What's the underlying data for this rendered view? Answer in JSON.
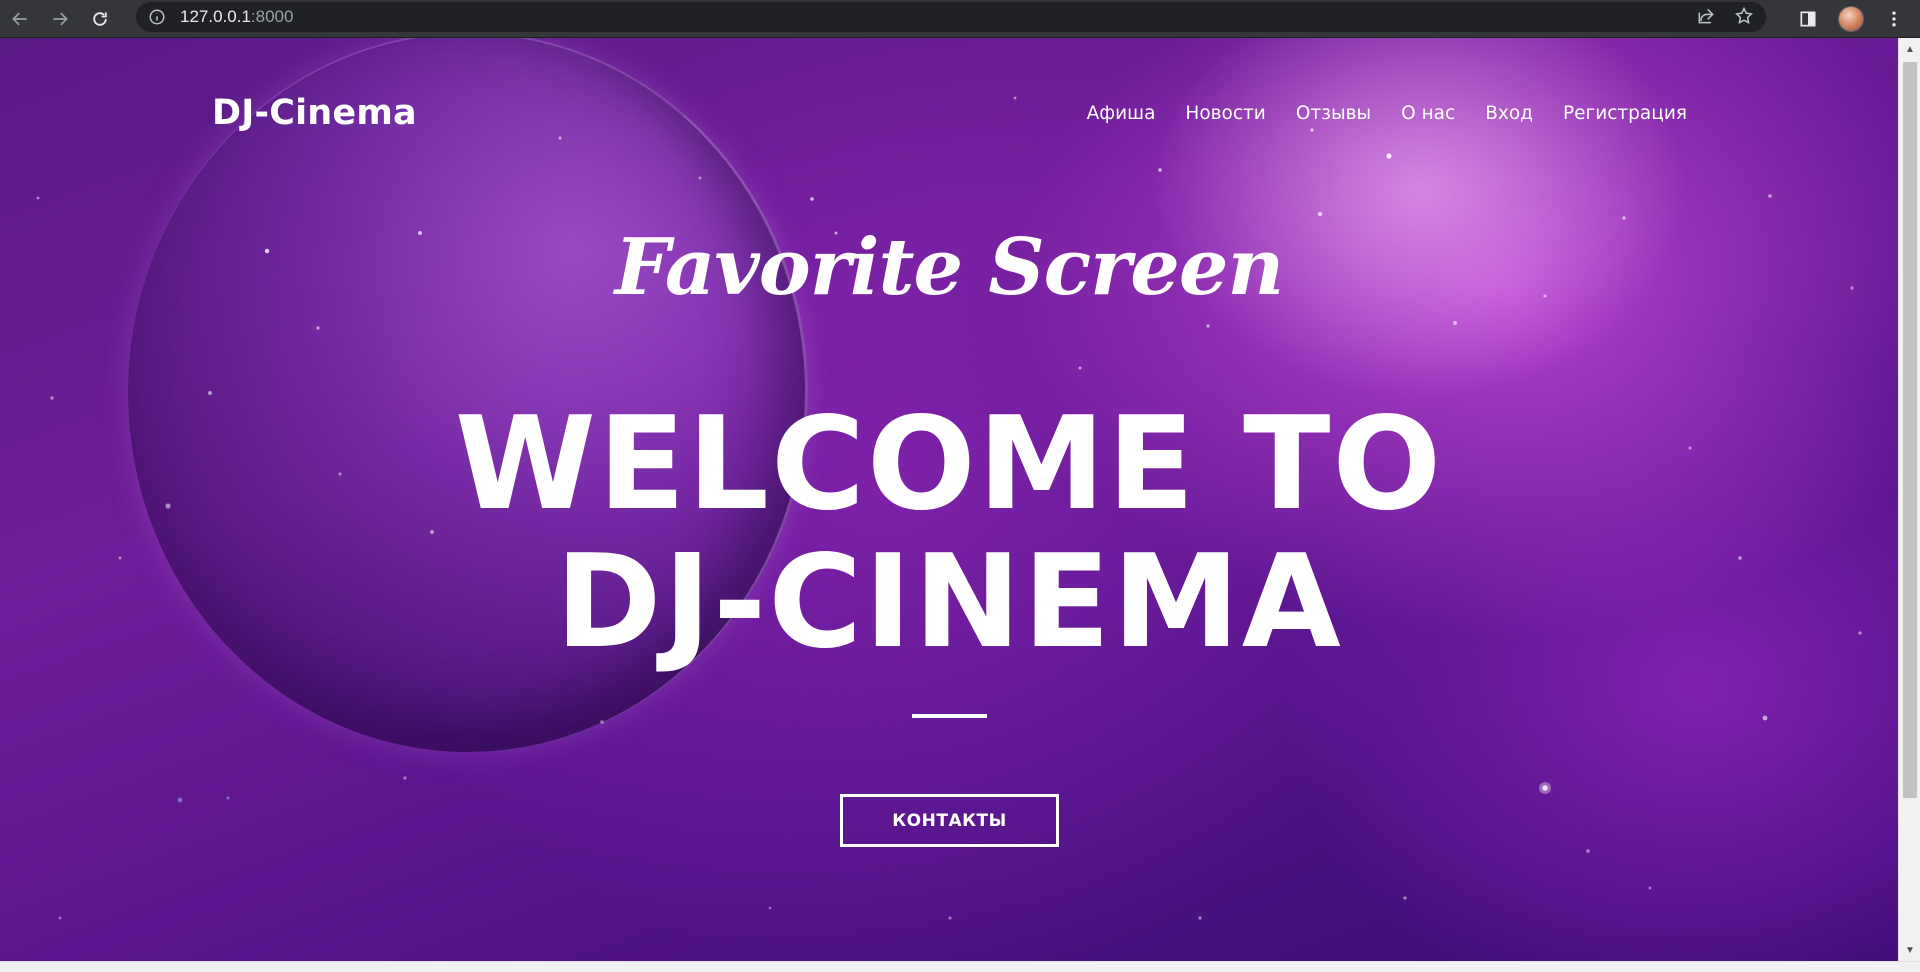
{
  "browser": {
    "url_host": "127.0.0.1",
    "url_port": ":8000",
    "icons": {
      "back": "arrow-left-icon",
      "forward": "arrow-right-icon",
      "reload": "reload-icon",
      "site_info": "info-icon",
      "share": "share-icon",
      "bookmark": "star-icon",
      "side_panel": "side-panel-icon",
      "profile": "avatar",
      "menu": "kebab-menu-icon"
    }
  },
  "site": {
    "brand": "DJ-Cinema",
    "nav": [
      {
        "label": "Афиша"
      },
      {
        "label": "Новости"
      },
      {
        "label": "Отзывы"
      },
      {
        "label": "О нас"
      },
      {
        "label": "Вход"
      },
      {
        "label": "Регистрация"
      }
    ]
  },
  "hero": {
    "subtitle": "Favorite Screen",
    "title_line1": "WELCOME TO",
    "title_line2": "DJ-CINEMA",
    "button_label": "КОНТАКТЫ"
  },
  "colors": {
    "background_primary": "#6f1e9a",
    "background_glow": "#d650e6",
    "text": "#ffffff"
  }
}
